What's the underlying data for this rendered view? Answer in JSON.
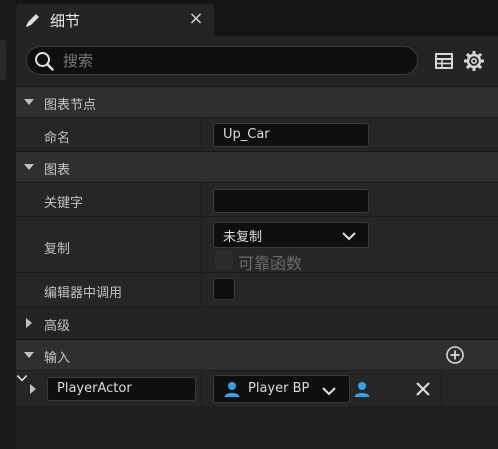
{
  "tab": {
    "title": "细节",
    "close_glyph": "×",
    "icon": "pencil-icon"
  },
  "search": {
    "placeholder": "搜索",
    "value": "",
    "icon": "search-icon"
  },
  "toolbar": {
    "table_icon": "table-icon",
    "settings_icon": "gear-icon"
  },
  "categories": [
    {
      "label": "图表节点",
      "expanded": true
    },
    {
      "label": "图表",
      "expanded": true
    },
    {
      "label": "高级",
      "expanded": false
    },
    {
      "label": "输入",
      "expanded": true
    }
  ],
  "graph_node": {
    "name_label": "命名",
    "name_value": "Up_Car"
  },
  "graph": {
    "keyword_label": "关键字",
    "keyword_value": "",
    "replication_label": "复制",
    "replication_value": "未复制",
    "reliable_label": "可靠函数",
    "reliable_checked": false,
    "call_in_editor_label": "编辑器中调用",
    "call_in_editor_checked": false
  },
  "inputs": {
    "add_icon": "plus-circle-icon",
    "items": [
      {
        "name": "PlayerActor",
        "type": "Player BP",
        "type_color": "#3aa0e0"
      }
    ]
  },
  "colors": {
    "accent_blue": "#3aa0e0",
    "panel_bg": "#242424",
    "field_bg": "#0f0f0f"
  }
}
